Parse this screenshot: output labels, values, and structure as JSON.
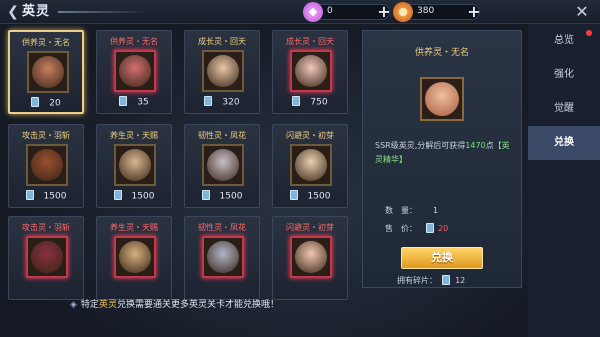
{
  "header": {
    "title": "英灵",
    "currencies": [
      {
        "icon": "gem-icon",
        "value": "0"
      },
      {
        "icon": "coin-icon",
        "value": "380"
      }
    ]
  },
  "cards": [
    {
      "name": "供养灵・无名",
      "cost": "20",
      "red": false,
      "selected": true,
      "face": "#c88060"
    },
    {
      "name": "供养灵・无名",
      "cost": "35",
      "red": true,
      "selected": false,
      "face": "#d07070"
    },
    {
      "name": "成长灵・回天",
      "cost": "320",
      "red": false,
      "selected": false,
      "face": "#e8c8a8"
    },
    {
      "name": "成长灵・回天",
      "cost": "750",
      "red": true,
      "selected": false,
      "face": "#f0c8b8"
    },
    {
      "name": "攻击灵・羽斩",
      "cost": "1500",
      "red": false,
      "selected": false,
      "face": "#9a5030"
    },
    {
      "name": "养生灵・天赐",
      "cost": "1500",
      "red": false,
      "selected": false,
      "face": "#d8b890"
    },
    {
      "name": "韧性灵・凤花",
      "cost": "1500",
      "red": false,
      "selected": false,
      "face": "#c8c0c8"
    },
    {
      "name": "闪避灵・初芽",
      "cost": "1500",
      "red": false,
      "selected": false,
      "face": "#e8d0b0"
    },
    {
      "name": "攻击灵・羽斩",
      "cost": "",
      "red": true,
      "selected": false,
      "face": "#8a3040"
    },
    {
      "name": "养生灵・天赐",
      "cost": "",
      "red": true,
      "selected": false,
      "face": "#d8b080"
    },
    {
      "name": "韧性灵・凤花",
      "cost": "",
      "red": true,
      "selected": false,
      "face": "#b0b8c8"
    },
    {
      "name": "闪避灵・初芽",
      "cost": "",
      "red": true,
      "selected": false,
      "face": "#f0c8b0"
    }
  ],
  "notice": {
    "pre": "特定",
    "highlight": "英灵",
    "post": "兑换需要通关更多英灵关卡才能兑换哦！"
  },
  "detail": {
    "name": "供养灵・无名",
    "desc_pre": "SSR级英灵,分解后可获得",
    "desc_num": "1470",
    "desc_mid": "点",
    "desc_tag": "【英灵精华】",
    "qty_label": "数　量：",
    "qty_value": "1",
    "price_label": "售　价：",
    "price_value": "20",
    "button": "兑换",
    "owned_label": "拥有碎片：",
    "owned_value": "12"
  },
  "tabs": [
    {
      "label": "总览",
      "active": false,
      "dot": true
    },
    {
      "label": "强化",
      "active": false,
      "dot": false
    },
    {
      "label": "觉醒",
      "active": false,
      "dot": false
    },
    {
      "label": "兑换",
      "active": true,
      "dot": false
    }
  ]
}
